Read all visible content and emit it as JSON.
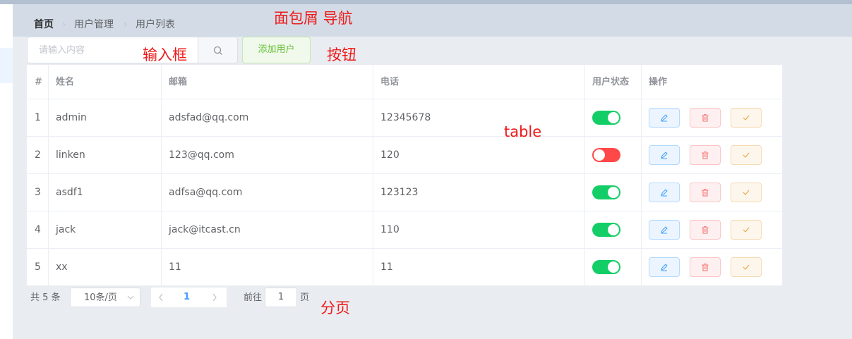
{
  "breadcrumb": [
    "首页",
    "用户管理",
    "用户列表"
  ],
  "annotations": {
    "breadcrumb": "面包屑 导航",
    "input": "输入框",
    "button": "按钮",
    "table": "table",
    "pagination": "分页"
  },
  "search": {
    "placeholder": "请输入内容",
    "icon": "search-icon"
  },
  "add_button": {
    "label": "添加用户"
  },
  "table": {
    "columns": [
      "#",
      "姓名",
      "邮箱",
      "电话",
      "用户状态",
      "操作"
    ],
    "rows": [
      {
        "index": "1",
        "name": "admin",
        "email": "adsfad@qq.com",
        "phone": "12345678",
        "status": true
      },
      {
        "index": "2",
        "name": "linken",
        "email": "123@qq.com",
        "phone": "120",
        "status": false
      },
      {
        "index": "3",
        "name": "asdf1",
        "email": "adfsa@qq.com",
        "phone": "123123",
        "status": true
      },
      {
        "index": "4",
        "name": "jack",
        "email": "jack@itcast.cn",
        "phone": "110",
        "status": true
      },
      {
        "index": "5",
        "name": "xx",
        "email": "11",
        "phone": "11",
        "status": true
      }
    ],
    "action_icons": [
      "edit-icon",
      "delete-icon",
      "assign-role-icon"
    ]
  },
  "pagination": {
    "total": "共 5 条",
    "page_size": "10条/页",
    "current_page": "1",
    "goto_label": "前往",
    "goto_value": "1",
    "page_unit": "页"
  },
  "colors": {
    "switch_on": "#13ce66",
    "switch_off": "#ff4949",
    "primary": "#409eff",
    "success": "#67c23a",
    "annotation": "#ee1a1a"
  }
}
